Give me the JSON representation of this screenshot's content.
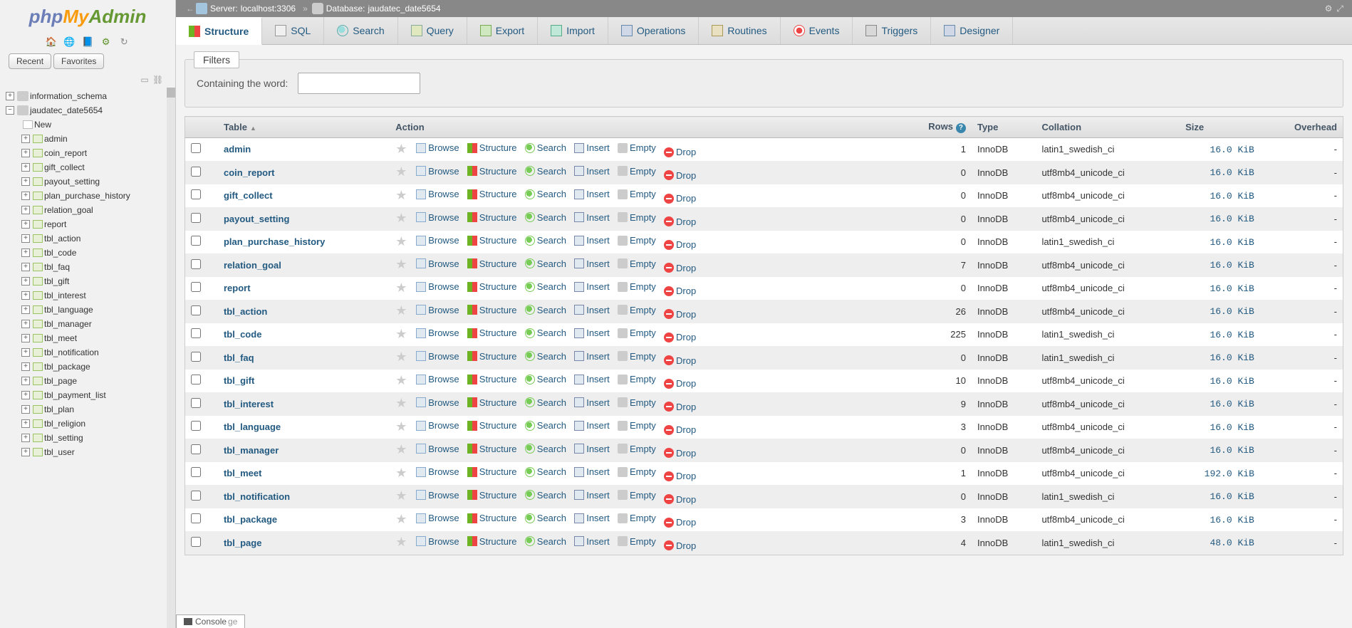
{
  "logo": {
    "php": "php",
    "my": "My",
    "admin": "Admin"
  },
  "sidebar_tabs": {
    "recent": "Recent",
    "favorites": "Favorites"
  },
  "tree": {
    "root1": "information_schema",
    "root2": "jaudatec_date5654",
    "new": "New",
    "tables": [
      "admin",
      "coin_report",
      "gift_collect",
      "payout_setting",
      "plan_purchase_history",
      "relation_goal",
      "report",
      "tbl_action",
      "tbl_code",
      "tbl_faq",
      "tbl_gift",
      "tbl_interest",
      "tbl_language",
      "tbl_manager",
      "tbl_meet",
      "tbl_notification",
      "tbl_package",
      "tbl_page",
      "tbl_payment_list",
      "tbl_plan",
      "tbl_religion",
      "tbl_setting",
      "tbl_user"
    ]
  },
  "breadcrumb": {
    "server_label": "Server:",
    "server": "localhost:3306",
    "db_label": "Database:",
    "db": "jaudatec_date5654"
  },
  "tabs": [
    {
      "id": "structure",
      "label": "Structure"
    },
    {
      "id": "sql",
      "label": "SQL"
    },
    {
      "id": "search",
      "label": "Search"
    },
    {
      "id": "query",
      "label": "Query"
    },
    {
      "id": "export",
      "label": "Export"
    },
    {
      "id": "import",
      "label": "Import"
    },
    {
      "id": "operations",
      "label": "Operations"
    },
    {
      "id": "routines",
      "label": "Routines"
    },
    {
      "id": "events",
      "label": "Events"
    },
    {
      "id": "triggers",
      "label": "Triggers"
    },
    {
      "id": "designer",
      "label": "Designer"
    }
  ],
  "filters": {
    "title": "Filters",
    "label": "Containing the word:"
  },
  "columns": {
    "table": "Table",
    "action": "Action",
    "rows": "Rows",
    "type": "Type",
    "collation": "Collation",
    "size": "Size",
    "overhead": "Overhead"
  },
  "actions": {
    "browse": "Browse",
    "structure": "Structure",
    "search": "Search",
    "insert": "Insert",
    "empty": "Empty",
    "drop": "Drop"
  },
  "rows": [
    {
      "name": "admin",
      "rows": "1",
      "type": "InnoDB",
      "collation": "latin1_swedish_ci",
      "size": "16.0 KiB",
      "overhead": "-"
    },
    {
      "name": "coin_report",
      "rows": "0",
      "type": "InnoDB",
      "collation": "utf8mb4_unicode_ci",
      "size": "16.0 KiB",
      "overhead": "-"
    },
    {
      "name": "gift_collect",
      "rows": "0",
      "type": "InnoDB",
      "collation": "utf8mb4_unicode_ci",
      "size": "16.0 KiB",
      "overhead": "-"
    },
    {
      "name": "payout_setting",
      "rows": "0",
      "type": "InnoDB",
      "collation": "utf8mb4_unicode_ci",
      "size": "16.0 KiB",
      "overhead": "-"
    },
    {
      "name": "plan_purchase_history",
      "rows": "0",
      "type": "InnoDB",
      "collation": "latin1_swedish_ci",
      "size": "16.0 KiB",
      "overhead": "-"
    },
    {
      "name": "relation_goal",
      "rows": "7",
      "type": "InnoDB",
      "collation": "utf8mb4_unicode_ci",
      "size": "16.0 KiB",
      "overhead": "-"
    },
    {
      "name": "report",
      "rows": "0",
      "type": "InnoDB",
      "collation": "utf8mb4_unicode_ci",
      "size": "16.0 KiB",
      "overhead": "-"
    },
    {
      "name": "tbl_action",
      "rows": "26",
      "type": "InnoDB",
      "collation": "utf8mb4_unicode_ci",
      "size": "16.0 KiB",
      "overhead": "-"
    },
    {
      "name": "tbl_code",
      "rows": "225",
      "type": "InnoDB",
      "collation": "latin1_swedish_ci",
      "size": "16.0 KiB",
      "overhead": "-"
    },
    {
      "name": "tbl_faq",
      "rows": "0",
      "type": "InnoDB",
      "collation": "latin1_swedish_ci",
      "size": "16.0 KiB",
      "overhead": "-"
    },
    {
      "name": "tbl_gift",
      "rows": "10",
      "type": "InnoDB",
      "collation": "utf8mb4_unicode_ci",
      "size": "16.0 KiB",
      "overhead": "-"
    },
    {
      "name": "tbl_interest",
      "rows": "9",
      "type": "InnoDB",
      "collation": "utf8mb4_unicode_ci",
      "size": "16.0 KiB",
      "overhead": "-"
    },
    {
      "name": "tbl_language",
      "rows": "3",
      "type": "InnoDB",
      "collation": "utf8mb4_unicode_ci",
      "size": "16.0 KiB",
      "overhead": "-"
    },
    {
      "name": "tbl_manager",
      "rows": "0",
      "type": "InnoDB",
      "collation": "utf8mb4_unicode_ci",
      "size": "16.0 KiB",
      "overhead": "-"
    },
    {
      "name": "tbl_meet",
      "rows": "1",
      "type": "InnoDB",
      "collation": "utf8mb4_unicode_ci",
      "size": "192.0 KiB",
      "overhead": "-"
    },
    {
      "name": "tbl_notification",
      "rows": "0",
      "type": "InnoDB",
      "collation": "latin1_swedish_ci",
      "size": "16.0 KiB",
      "overhead": "-"
    },
    {
      "name": "tbl_package",
      "rows": "3",
      "type": "InnoDB",
      "collation": "utf8mb4_unicode_ci",
      "size": "16.0 KiB",
      "overhead": "-"
    },
    {
      "name": "tbl_page",
      "rows": "4",
      "type": "InnoDB",
      "collation": "latin1_swedish_ci",
      "size": "48.0 KiB",
      "overhead": "-"
    }
  ],
  "partial_row_suffix": "ge",
  "console": "Console"
}
